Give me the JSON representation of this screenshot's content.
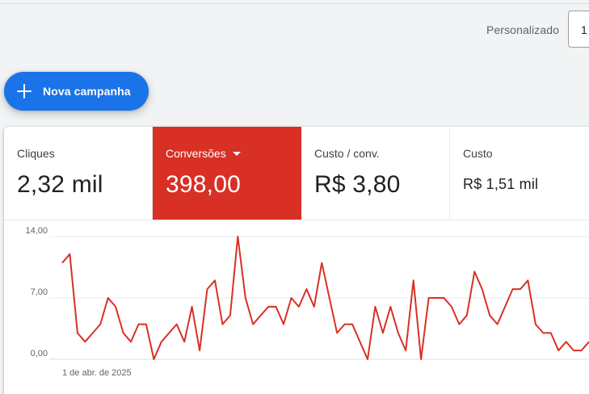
{
  "header": {
    "date_range_label": "Personalizado",
    "date_range_value": "1"
  },
  "fab": {
    "label": "Nova campanha"
  },
  "metrics": [
    {
      "label": "Cliques",
      "value": "2,32 mil"
    },
    {
      "label": "Conversões",
      "value": "398,00"
    },
    {
      "label": "Custo / conv.",
      "value": "R$ 3,80"
    },
    {
      "label": "Custo",
      "value": "R$ 1,51 mil"
    }
  ],
  "colors": {
    "accent": "#1a73e8",
    "active_metric": "#d93025",
    "series_line": "#d93025"
  },
  "chart_data": {
    "type": "line",
    "title": "",
    "xlabel": "",
    "ylabel": "",
    "x_tick_labels": [
      "1 de abr. de 2025"
    ],
    "y_ticks": [
      "14,00",
      "7,00",
      "0,00"
    ],
    "ylim": [
      0,
      14
    ],
    "grid": true,
    "series": [
      {
        "values": [
          11,
          12,
          3,
          2,
          3,
          4,
          7,
          6,
          3,
          2,
          4,
          4,
          0,
          2,
          3,
          4,
          2,
          6,
          1,
          8,
          9,
          4,
          5,
          14,
          7,
          4,
          5,
          6,
          6,
          4,
          7,
          6,
          8,
          6,
          11,
          7,
          3,
          4,
          4,
          2,
          0,
          6,
          3,
          6,
          3,
          1,
          9,
          0,
          7,
          7,
          7,
          6,
          4,
          5,
          10,
          8,
          5,
          4,
          6,
          8,
          8,
          9,
          4,
          3,
          3,
          1,
          2,
          1,
          1,
          2
        ]
      }
    ]
  }
}
